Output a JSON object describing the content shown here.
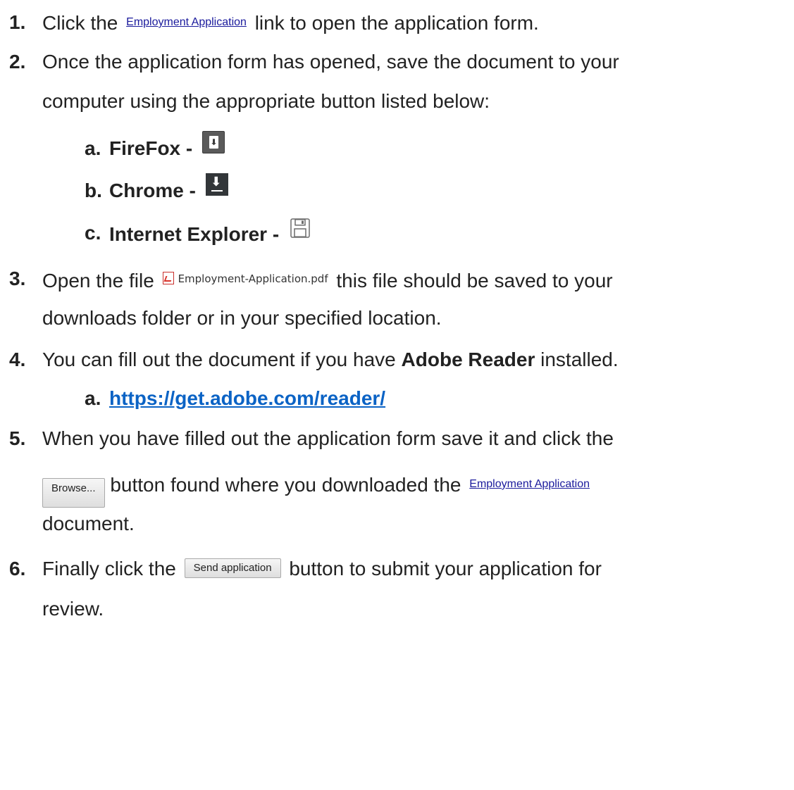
{
  "steps": {
    "s1": {
      "num": "1.",
      "pre": "Click the",
      "link": "Employment Application",
      "post": "link to open the application form."
    },
    "s2": {
      "num": "2.",
      "line1": "Once the application form has opened, save the document to your",
      "line2": "computer using the appropriate button listed below:",
      "subs": [
        {
          "letter": "a.",
          "label": "FireFox -",
          "icon": "firefox-download-icon"
        },
        {
          "letter": "b.",
          "label": "Chrome -",
          "icon": "chrome-download-icon"
        },
        {
          "letter": "c.",
          "label": "Internet Explorer -",
          "icon": "floppy-disk-save-icon"
        }
      ]
    },
    "s3": {
      "num": "3.",
      "pre": "Open the file",
      "file": "Employment-Application.pdf",
      "post": "this file should be saved to your",
      "line2": "downloads folder or in your specified location."
    },
    "s4": {
      "num": "4.",
      "pre": "You can fill out the document if you have",
      "bold": "Adobe Reader",
      "post": "installed.",
      "sub_letter": "a.",
      "url": "https://get.adobe.com/reader/"
    },
    "s5": {
      "num": "5.",
      "line1": "When you have filled out the application form save it and click the",
      "button": "Browse...",
      "mid": "button found where you downloaded the",
      "link": "Employment Application",
      "line3": "document."
    },
    "s6": {
      "num": "6.",
      "pre": "Finally click the",
      "button": "Send application",
      "post": "button to submit your application for",
      "line2": "review."
    }
  },
  "colors": {
    "text": "#222222",
    "link": "#0b63c5",
    "inline_link": "#1a1a9c",
    "pdf_red": "#d9342b"
  }
}
